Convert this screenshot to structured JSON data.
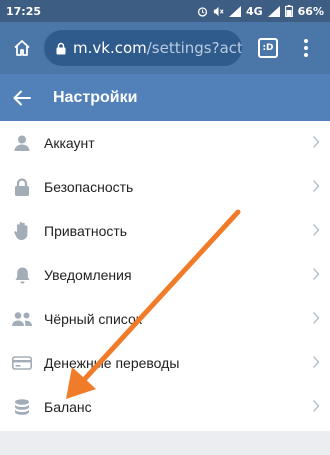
{
  "status_bar": {
    "time": "17:25",
    "network": "4G",
    "battery": "66%"
  },
  "browser": {
    "url_host": "m.vk.com",
    "url_path": "/settings?act=",
    "tab_label": ":D"
  },
  "header": {
    "title": "Настройки"
  },
  "settings": [
    {
      "label": "Аккаунт",
      "icon": "user-icon"
    },
    {
      "label": "Безопасность",
      "icon": "lock-icon"
    },
    {
      "label": "Приватность",
      "icon": "hand-icon"
    },
    {
      "label": "Уведомления",
      "icon": "bell-icon"
    },
    {
      "label": "Чёрный список",
      "icon": "users-icon"
    },
    {
      "label": "Денежные переводы",
      "icon": "money-transfer-icon"
    },
    {
      "label": "Баланс",
      "icon": "coins-icon"
    }
  ],
  "colors": {
    "status_bar": "#3e5d82",
    "browser_bar": "#4a76a8",
    "header": "#5181b8",
    "icon_gray": "#a3adb8",
    "annotation_arrow": "#f07c2a"
  }
}
